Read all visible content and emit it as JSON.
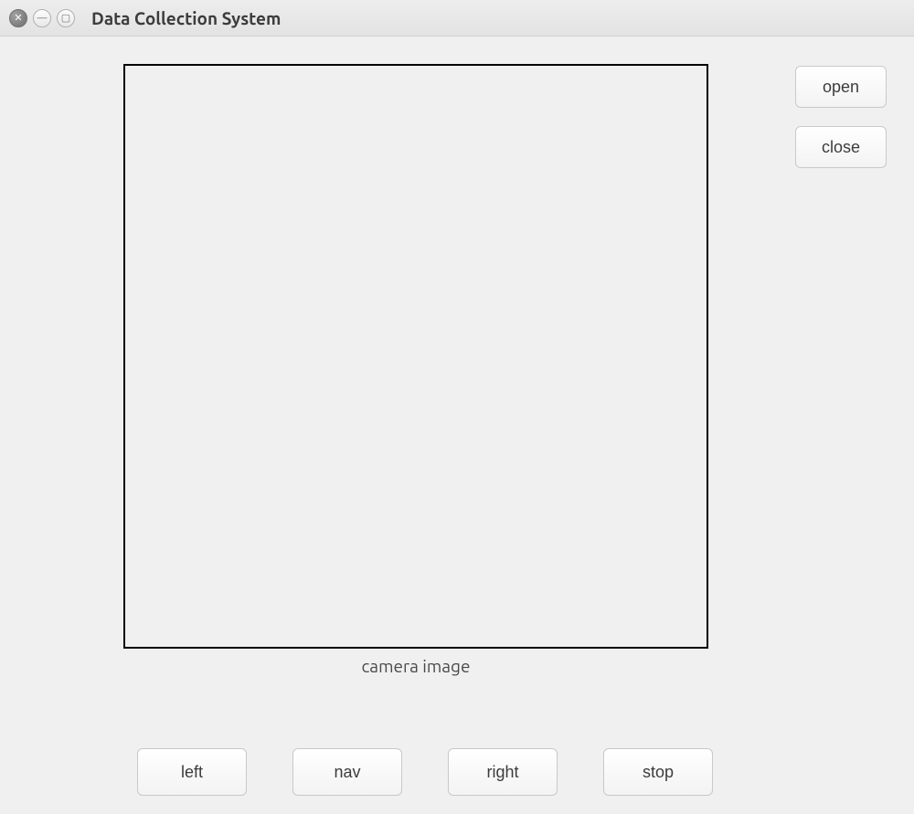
{
  "window": {
    "title": "Data Collection System"
  },
  "sideButtons": {
    "open": "open",
    "close": "close"
  },
  "cameraLabel": "camera image",
  "bottomButtons": {
    "left": "left",
    "nav": "nav",
    "right": "right",
    "stop": "stop"
  },
  "icons": {
    "close": "✕",
    "minimize": "—",
    "maximize": "▢"
  }
}
